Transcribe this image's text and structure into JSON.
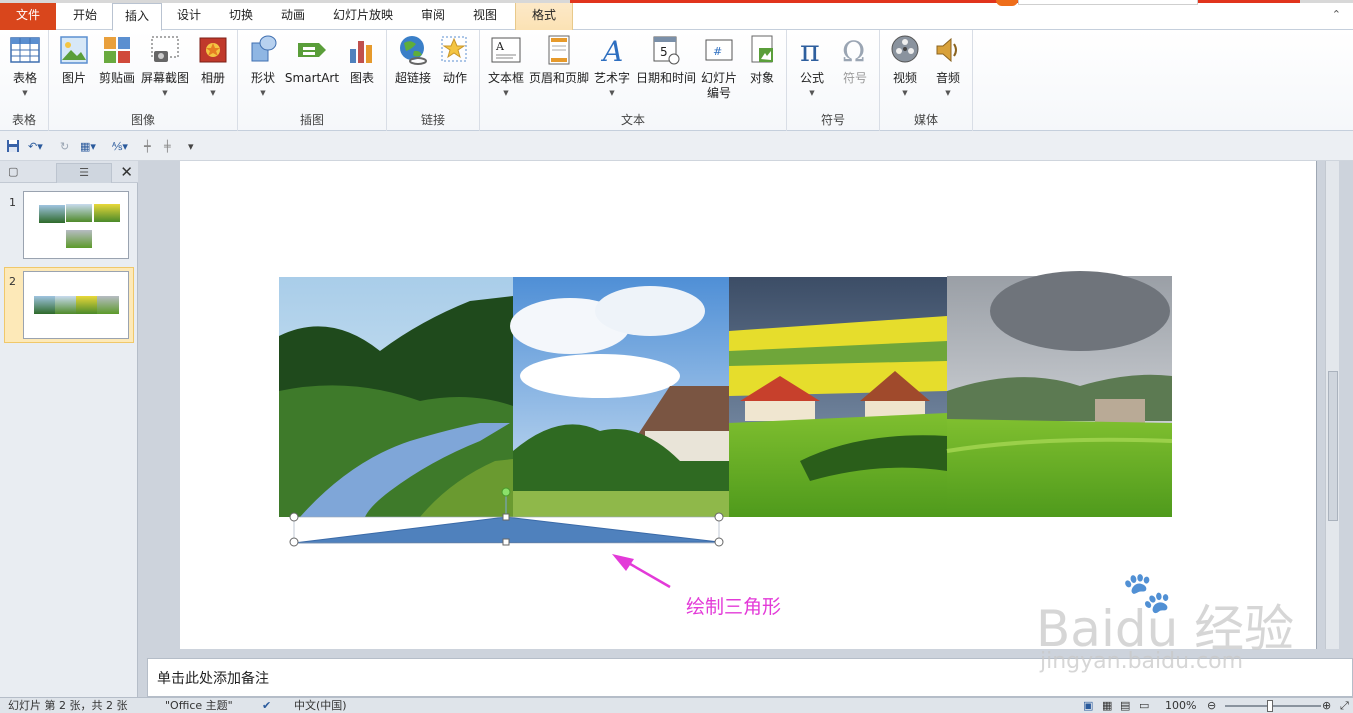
{
  "tabs": {
    "file": "文件",
    "items": [
      "开始",
      "插入",
      "设计",
      "切换",
      "动画",
      "幻灯片放映",
      "审阅",
      "视图",
      "格式"
    ],
    "active": "插入",
    "contextual": "格式"
  },
  "ribbon": {
    "groups": {
      "table": "表格",
      "images": "图像",
      "illustrations": "插图",
      "links": "链接",
      "text": "文本",
      "symbols": "符号",
      "media": "媒体"
    },
    "buttons": {
      "table": "表格",
      "picture": "图片",
      "clipart": "剪贴画",
      "screenshot": "屏幕截图",
      "album": "相册",
      "shapes": "形状",
      "smartart": "SmartArt",
      "chart": "图表",
      "hyperlink": "超链接",
      "action": "动作",
      "textbox": "文本框",
      "header_footer": "页眉和页脚",
      "wordart": "艺术字",
      "datetime": "日期和时间",
      "slide_number_1": "幻灯片",
      "slide_number_2": "编号",
      "object": "对象",
      "equation": "公式",
      "symbol": "符号",
      "video": "视频",
      "audio": "音频"
    }
  },
  "slides": [
    {
      "number": "1"
    },
    {
      "number": "2",
      "selected": true
    }
  ],
  "annotation": {
    "text": "绘制三角形",
    "color": "#e33ad8"
  },
  "notes": {
    "placeholder": "单击此处添加备注"
  },
  "status": {
    "slide_info": "幻灯片 第 2 张，共 2 张",
    "theme": "\"Office 主题\"",
    "language": "中文(中国)",
    "zoom": "100%"
  },
  "watermark": {
    "brand": "Baidu 经验",
    "url": "jingyan.baidu.com"
  },
  "colors": {
    "file_tab": "#d9461c",
    "shape_fill": "#4f81bd",
    "shape_stroke": "#3a6aa8",
    "selection": "#f0c86a"
  }
}
